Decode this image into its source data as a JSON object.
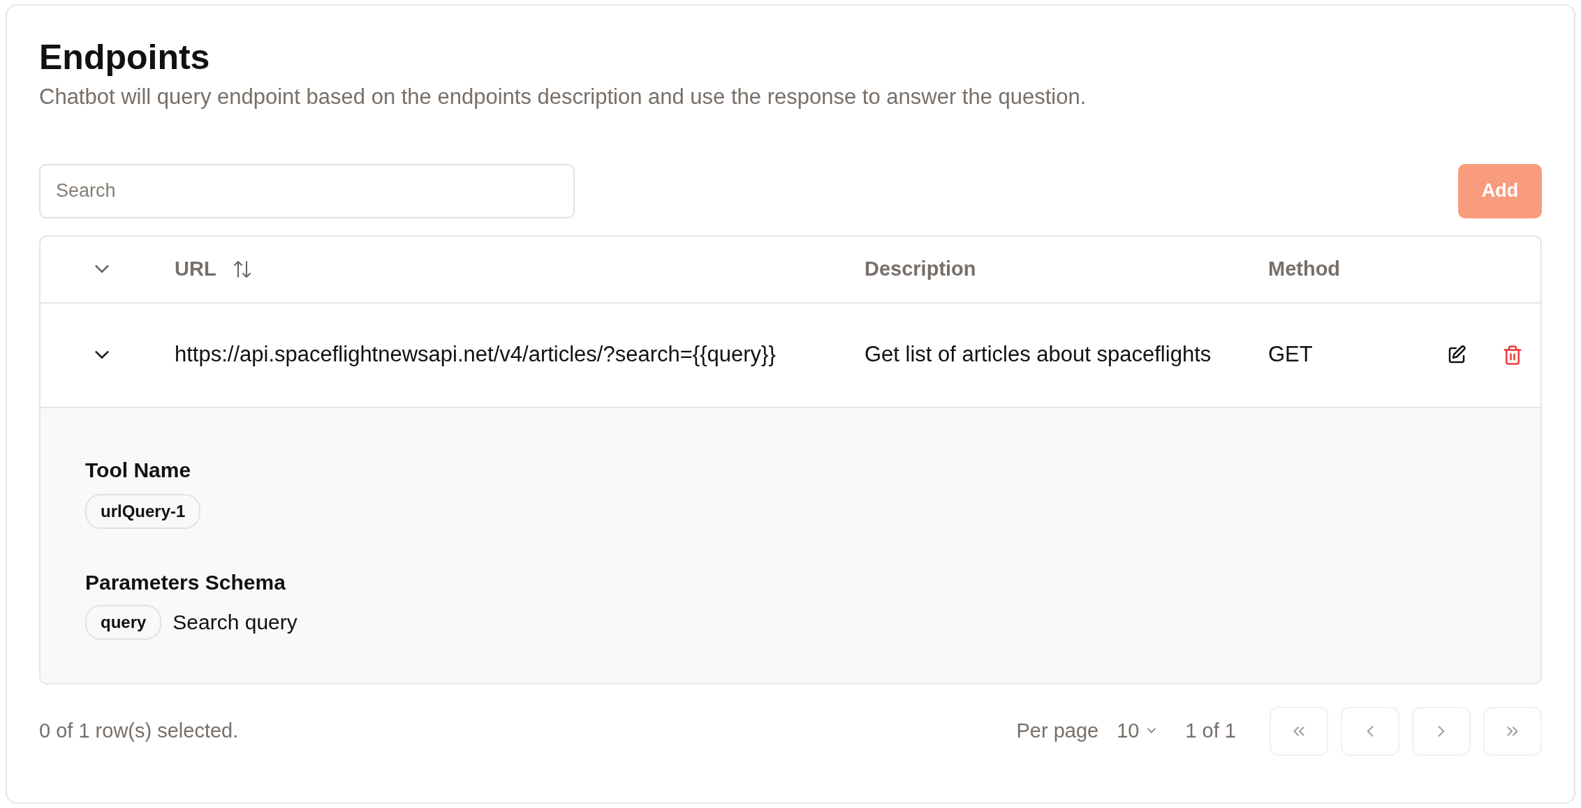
{
  "header": {
    "title": "Endpoints",
    "subtitle": "Chatbot will query endpoint based on the endpoints description and use the response to answer the question."
  },
  "search": {
    "placeholder": "Search"
  },
  "add_button": "Add",
  "table": {
    "columns": [
      {
        "label": "URL",
        "sortable": true
      },
      {
        "label": "Description",
        "sortable": false
      },
      {
        "label": "Method",
        "sortable": false
      }
    ],
    "rows": [
      {
        "expanded": true,
        "url": "https://api.spaceflightnewsapi.net/v4/articles/?search={{query}}",
        "description": "Get list of articles about spaceflights",
        "method": "GET",
        "details": {
          "tool_name_label": "Tool Name",
          "tool_name": "urlQuery-1",
          "schema_label": "Parameters Schema",
          "parameters": [
            {
              "name": "query",
              "description": "Search query"
            }
          ]
        }
      }
    ]
  },
  "footer": {
    "selection": "0 of 1 row(s) selected.",
    "per_page_label": "Per page",
    "per_page": "10",
    "page": "1 of 1",
    "pager": [
      {
        "kind": "first",
        "disabled": true
      },
      {
        "kind": "previous",
        "disabled": true
      },
      {
        "kind": "next",
        "disabled": true
      },
      {
        "kind": "last",
        "disabled": true
      }
    ]
  }
}
